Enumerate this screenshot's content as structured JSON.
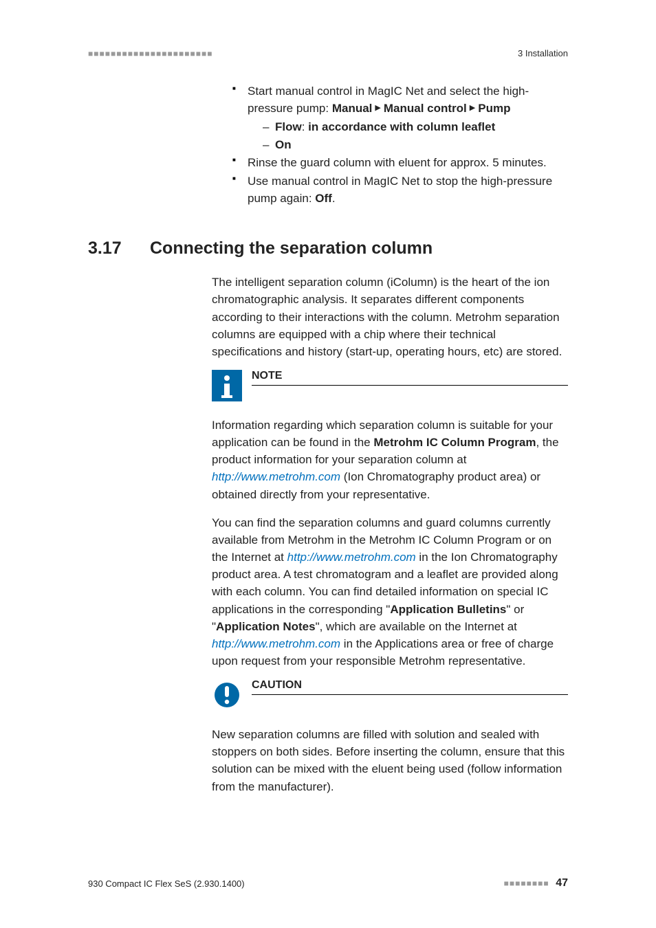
{
  "header": {
    "dots": "■■■■■■■■■■■■■■■■■■■■■■",
    "chapter": "3 Installation"
  },
  "continuation": {
    "i0_pre": "Start manual control in MagIC Net and select the high-pressure pump: ",
    "i0_b1": "Manual",
    "i0_b2": "Manual control",
    "i0_b3": "Pump",
    "triangle": "▶",
    "sub0_b1": "Flow",
    "sub0_t": ": ",
    "sub0_b2": "in accordance with column leaflet",
    "sub1_b": "On",
    "i1": "Rinse the guard column with eluent for approx. 5 minutes.",
    "i2_pre": "Use manual control in MagIC Net to stop the high-pressure pump again: ",
    "i2_b": "Off",
    "i2_post": "."
  },
  "section": {
    "num": "3.17",
    "title": "Connecting the separation column"
  },
  "intro": "The intelligent separation column (iColumn) is the heart of the ion chromatographic analysis. It separates different components according to their interactions with the column. Metrohm separation columns are equipped with a chip where their technical specifications and history (start-up, operating hours, etc) are stored.",
  "note": {
    "title": "NOTE",
    "t1": "Information regarding which separation column is suitable for your application can be found in the ",
    "b1": "Metrohm IC Column Program",
    "t2": ", the product information for your separation column at ",
    "link": "http://www.metrohm.com",
    "t3": " (Ion Chromatography product area) or obtained directly from your representative."
  },
  "para2": {
    "t1": "You can find the separation columns and guard columns currently available from Metrohm in the Metrohm IC Column Program or on the Internet at ",
    "link1": "http://www.metrohm.com",
    "t2": " in the Ion Chromatography product area. A test chromatogram and a leaflet are provided along with each column. You can find detailed information on special IC applications in the corresponding \"",
    "b1": "Application Bulletins",
    "t3": "\" or \"",
    "b2": "Application Notes",
    "t4": "\", which are available on the Internet at ",
    "link2": "http://www.metrohm.com",
    "t5": " in the Applications area or free of charge upon request from your responsible Metrohm representative."
  },
  "caution": {
    "title": "CAUTION",
    "body": "New separation columns are filled with solution and sealed with stoppers on both sides. Before inserting the column, ensure that this solution can be mixed with the eluent being used (follow information from the manufacturer)."
  },
  "footer": {
    "doc": "930 Compact IC Flex SeS (2.930.1400)",
    "dots": "■■■■■■■■",
    "pnum": "47"
  }
}
